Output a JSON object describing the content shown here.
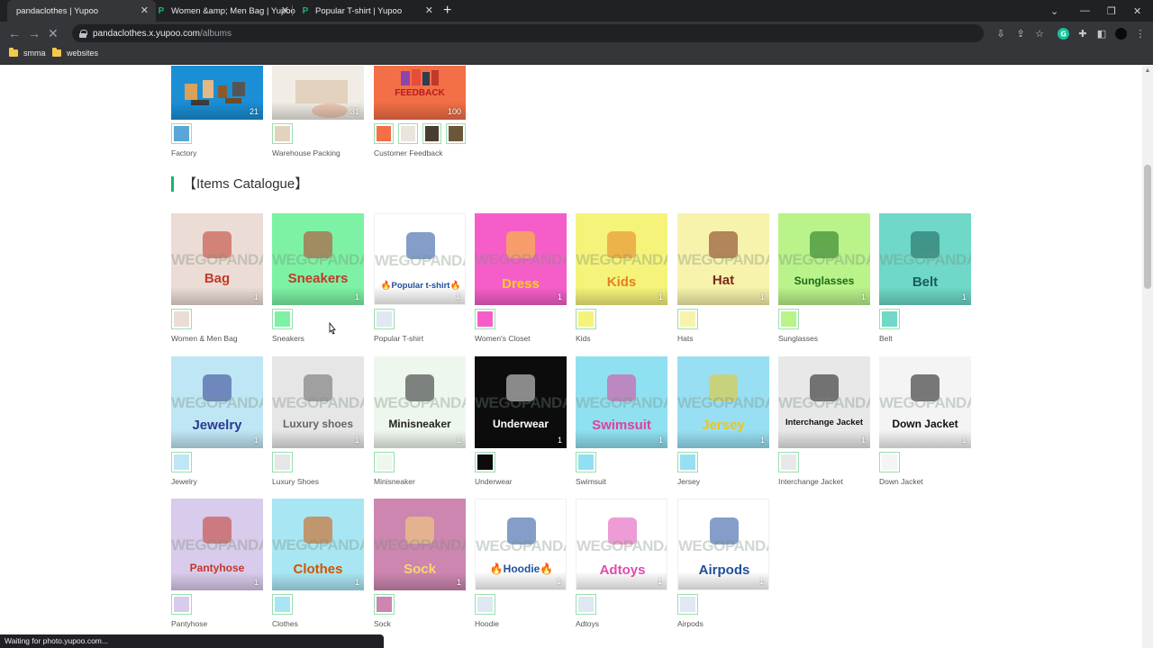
{
  "browser": {
    "tabs": [
      {
        "title": "pandaclothes | Yupoo",
        "active": true
      },
      {
        "title": "Women &amp; Men Bag | Yupoo",
        "active": false
      },
      {
        "title": "Popular T-shirt | Yupoo",
        "active": false
      }
    ],
    "new_tab": "+",
    "url_host": "pandaclothes.x.yupoo.com",
    "url_path": "/albums",
    "bookmarks": [
      "smma",
      "websites"
    ],
    "status": "Waiting for photo.yupoo.com..."
  },
  "top_albums": [
    {
      "name": "Factory",
      "count": "21",
      "color": "#1a8fd6"
    },
    {
      "name": "Warehouse Packing",
      "count": "31",
      "color": "#f1ede6"
    },
    {
      "name": "Customer Feedback",
      "count": "100",
      "color": "#f36f47",
      "label": "FEEDBACK"
    }
  ],
  "section": {
    "title": "【Items Catalogue】"
  },
  "watermark": "WEGOPANDA",
  "albums": [
    {
      "name": "Women & Men Bag",
      "label": "Bag",
      "count": "1",
      "bg": "#ecdcd6",
      "label_color": "#c0392b"
    },
    {
      "name": "Sneakers",
      "label": "Sneakers",
      "count": "1",
      "bg": "#7df2a4",
      "label_color": "#c0392b"
    },
    {
      "name": "Popular T-shirt",
      "label": "🔥Popular t-shirt🔥",
      "count": "1",
      "bg": "#ffffff",
      "label_color": "#1f4e9c"
    },
    {
      "name": "Women's Closet",
      "label": "Dress",
      "count": "1",
      "bg": "#f55ec9",
      "label_color": "#f7d11e"
    },
    {
      "name": "Kids",
      "label": "Kids",
      "count": "1",
      "bg": "#f5f37a",
      "label_color": "#e67e22"
    },
    {
      "name": "Hats",
      "label": "Hat",
      "count": "1",
      "bg": "#f7f3ac",
      "label_color": "#7a2a1a"
    },
    {
      "name": "Sunglasses",
      "label": "Sunglasses",
      "count": "1",
      "bg": "#b9f38a",
      "label_color": "#1a6b1a"
    },
    {
      "name": "Belt",
      "label": "Belt",
      "count": "1",
      "bg": "#6fd8c8",
      "label_color": "#1b5c55"
    },
    {
      "name": "Jewelry",
      "label": "Jewelry",
      "count": "1",
      "bg": "#bfe6f4",
      "label_color": "#2b3a8f"
    },
    {
      "name": "Luxury Shoes",
      "label": "Luxury shoes",
      "count": "1",
      "bg": "#e6e6e6",
      "label_color": "#666666"
    },
    {
      "name": "Minisneaker",
      "label": "Minisneaker",
      "count": "1",
      "bg": "#eef7ee",
      "label_color": "#222222"
    },
    {
      "name": "Underwear",
      "label": "Underwear",
      "count": "1",
      "bg": "#0c0c0c",
      "label_color": "#ffffff"
    },
    {
      "name": "Swimsuit",
      "label": "Swimsuit",
      "count": "1",
      "bg": "#8fe0f1",
      "label_color": "#e0409a"
    },
    {
      "name": "Jersey",
      "label": "Jersey",
      "count": "1",
      "bg": "#98dff3",
      "label_color": "#f0c419"
    },
    {
      "name": "Interchange Jacket",
      "label": "Interchange Jacket",
      "count": "1",
      "bg": "#e8e8e8",
      "label_color": "#111111"
    },
    {
      "name": "Down Jacket",
      "label": "Down Jacket",
      "count": "1",
      "bg": "#f4f4f4",
      "label_color": "#111111"
    },
    {
      "name": "Pantyhose",
      "label": "Pantyhose",
      "count": "1",
      "bg": "#d9cbeb",
      "label_color": "#c0392b"
    },
    {
      "name": "Clothes",
      "label": "Clothes",
      "count": "1",
      "bg": "#a9e6f3",
      "label_color": "#d35400"
    },
    {
      "name": "Sock",
      "label": "Sock",
      "count": "1",
      "bg": "#cc86b0",
      "label_color": "#f7d774"
    },
    {
      "name": "Hoodie",
      "label": "🔥Hoodie🔥",
      "count": "1",
      "bg": "#ffffff",
      "label_color": "#1f4e9c"
    },
    {
      "name": "Adtoys",
      "label": "Adtoys",
      "count": "1",
      "bg": "#ffffff",
      "label_color": "#e04bb2"
    },
    {
      "name": "Airpods",
      "label": "Airpods",
      "count": "1",
      "bg": "#ffffff",
      "label_color": "#1f4e9c"
    }
  ]
}
